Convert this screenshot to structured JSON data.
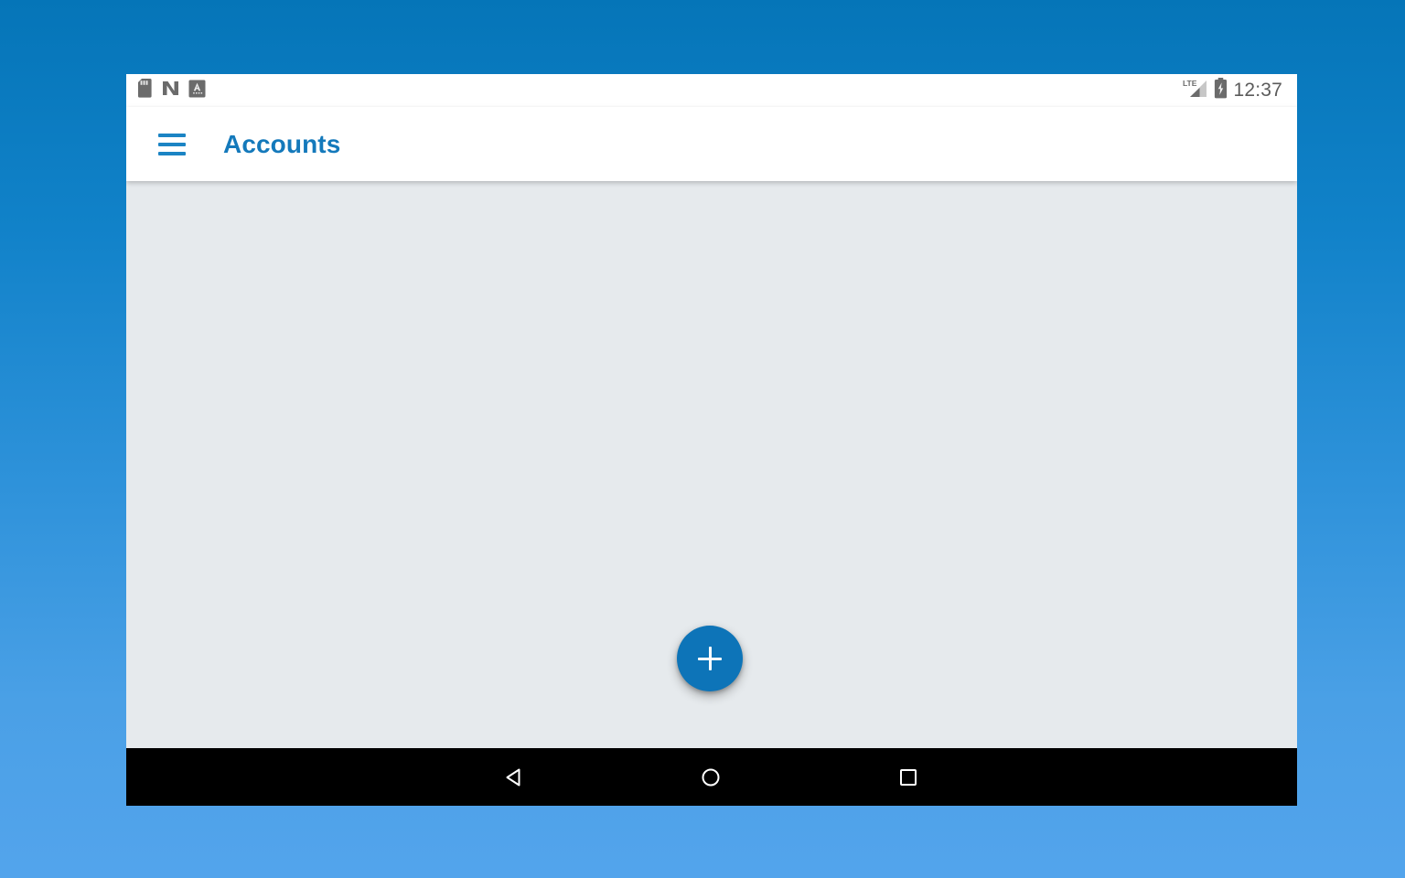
{
  "wallpaper": {
    "gradient_top": "#0575b8",
    "gradient_bottom": "#53a4ec"
  },
  "device": {
    "screen_background": "#ffffff",
    "content_background": "#e6eaed"
  },
  "status_bar": {
    "time": "12:37",
    "time_color": "#5b5b5b",
    "left_icons": [
      {
        "name": "sd-card-icon",
        "label": "SD card"
      },
      {
        "name": "nfc-icon",
        "label": "N"
      },
      {
        "name": "keyboard-input-icon",
        "label": "A"
      }
    ],
    "right_icons": [
      {
        "name": "lte-signal-icon",
        "label": "LTE"
      },
      {
        "name": "battery-charging-icon",
        "label": "Battery charging"
      }
    ]
  },
  "app_bar": {
    "title": "Accounts",
    "title_color": "#1479bb",
    "menu_icon": "hamburger-menu-icon",
    "menu_label": "Open navigation drawer"
  },
  "main": {
    "empty": true,
    "items": []
  },
  "fab": {
    "icon": "plus-icon",
    "label": "+",
    "accessible_label": "Add account",
    "color": "#0d74b8"
  },
  "navigation_bar": {
    "background": "#000000",
    "buttons": [
      {
        "name": "nav-back-button",
        "icon": "back-triangle-icon",
        "label": "Back"
      },
      {
        "name": "nav-home-button",
        "icon": "home-circle-icon",
        "label": "Home"
      },
      {
        "name": "nav-recents-button",
        "icon": "recents-square-icon",
        "label": "Recents"
      }
    ]
  }
}
